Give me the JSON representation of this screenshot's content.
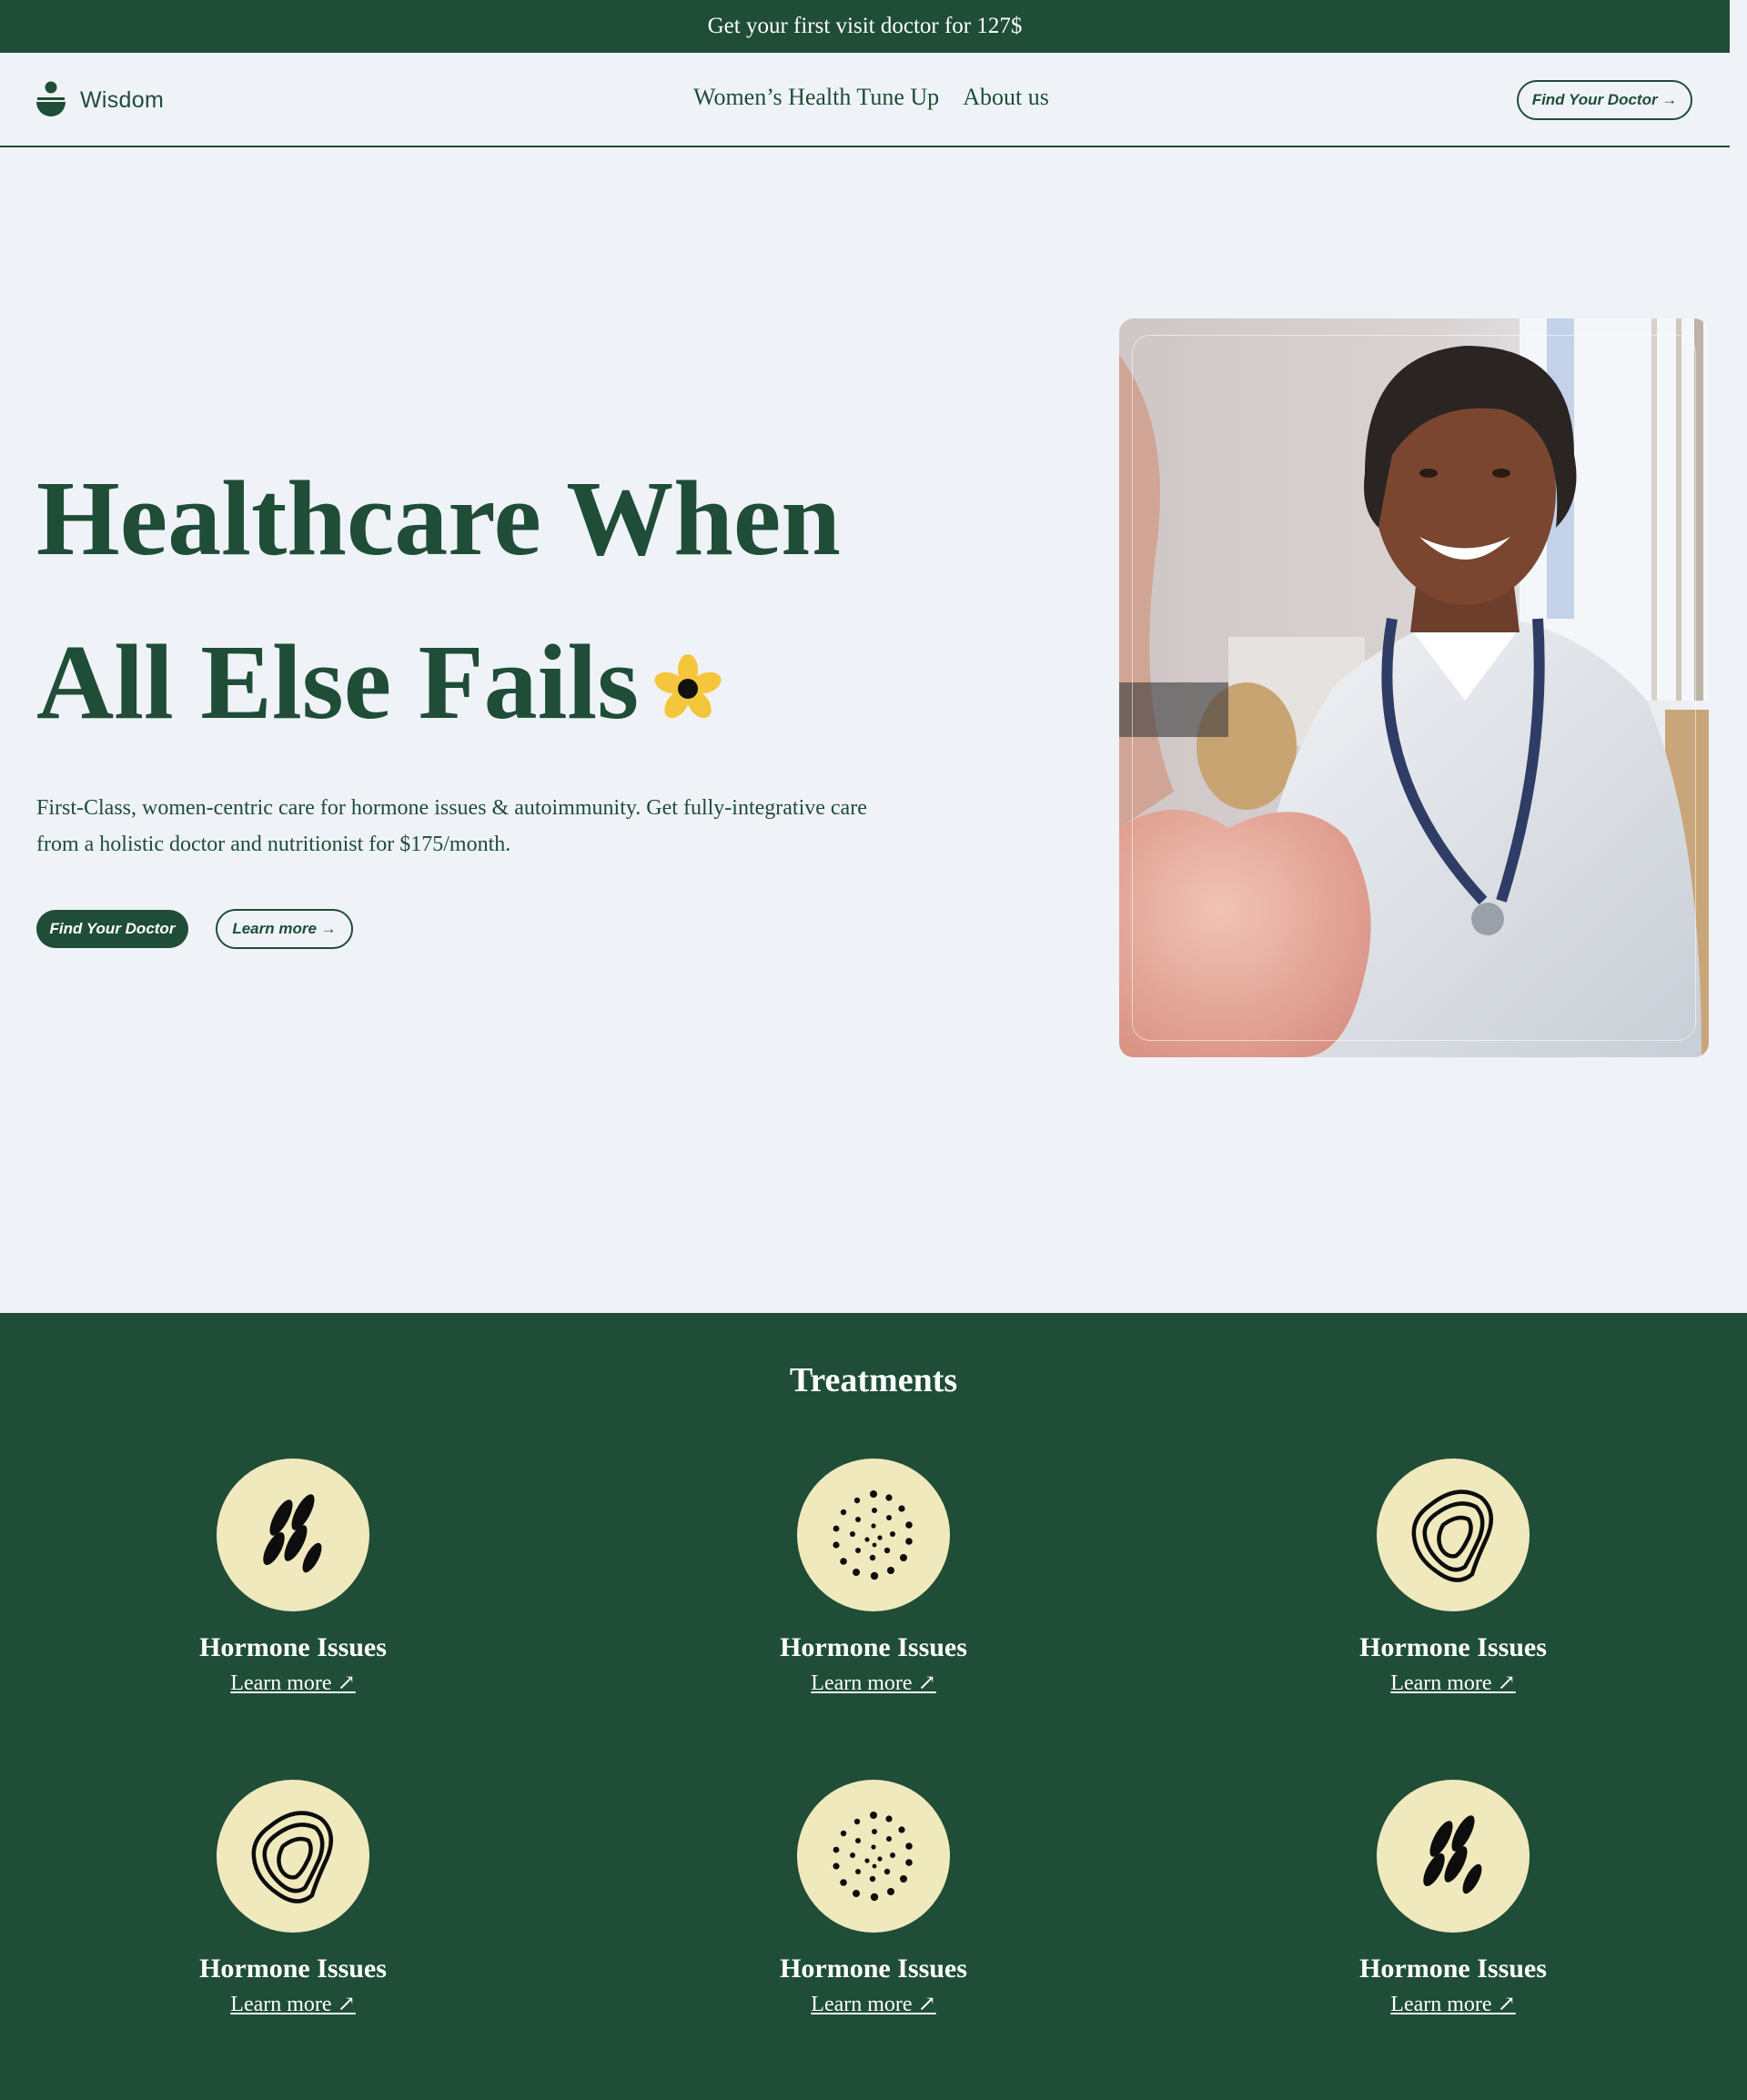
{
  "promo": {
    "text": "Get your first visit doctor for 127$"
  },
  "nav": {
    "brand": "Wisdom",
    "links": [
      "Women’s Health Tune Up",
      "About us"
    ],
    "cta": "Find Your Doctor →"
  },
  "hero": {
    "title_line1": "Healthcare When",
    "title_line2": "All Else Fails",
    "description": "First-Class, women-centric care for hormone issues & autoimmunity. Get fully-integrative care from a holistic doctor and nutritionist for $175/month.",
    "primary_button": "Find Your Doctor",
    "secondary_button": "Learn more →"
  },
  "treatments": {
    "title": "Treatments",
    "items": [
      {
        "name": "Hormone Issues",
        "link": "Learn more ↗",
        "icon": "seeds-icon"
      },
      {
        "name": "Hormone Issues",
        "link": "Learn more ↗",
        "icon": "dots-icon"
      },
      {
        "name": "Hormone Issues",
        "link": "Learn more ↗",
        "icon": "contour-icon"
      },
      {
        "name": "Hormone Issues",
        "link": "Learn more ↗",
        "icon": "contour-icon"
      },
      {
        "name": "Hormone Issues",
        "link": "Learn more ↗",
        "icon": "dots-icon"
      },
      {
        "name": "Hormone Issues",
        "link": "Learn more ↗",
        "icon": "seeds-icon"
      }
    ]
  },
  "colors": {
    "brand_green": "#1f4d37",
    "background": "#eff3f8",
    "icon_circle": "#f0e9bd",
    "flower_yellow": "#f5c63c"
  }
}
